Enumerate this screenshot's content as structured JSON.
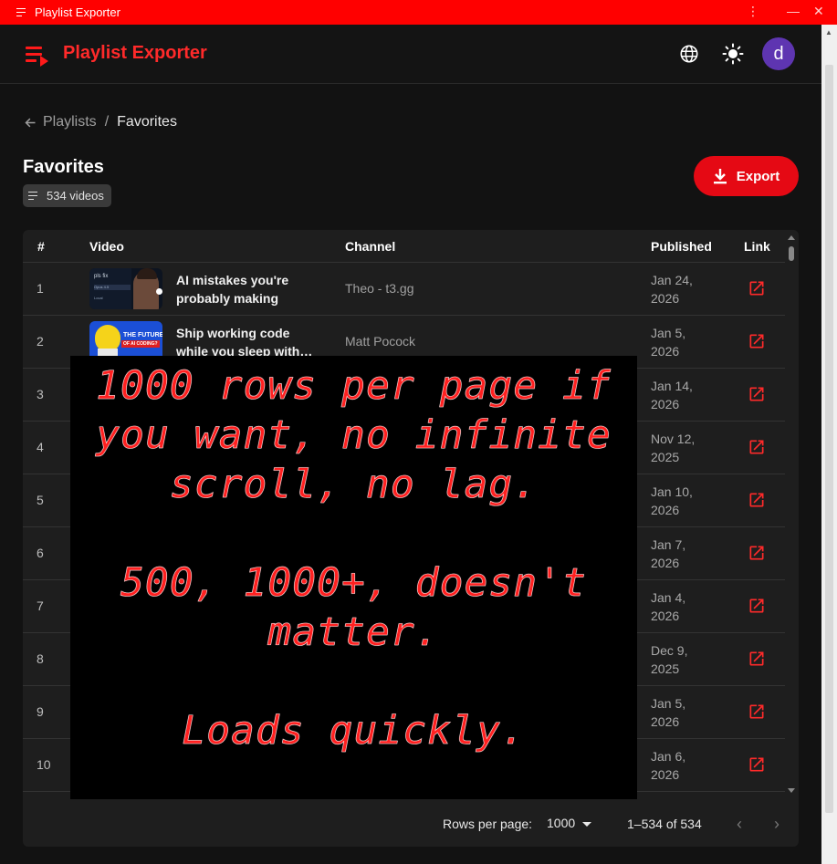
{
  "window": {
    "title": "Playlist Exporter",
    "controls": [
      "⋮",
      "—",
      "✕"
    ]
  },
  "appbar": {
    "title": "Playlist Exporter",
    "avatar_letter": "d",
    "icons": [
      "globe-icon",
      "sun-icon"
    ]
  },
  "breadcrumb": {
    "back_label": "Playlists",
    "separator": "/",
    "current": "Favorites"
  },
  "page": {
    "title": "Favorites",
    "video_count": "534 videos"
  },
  "export_button": {
    "label": "Export"
  },
  "table": {
    "columns": [
      "#",
      "Video",
      "Channel",
      "Published",
      "Link"
    ],
    "rows": [
      {
        "num": "1",
        "title_line1": "AI mistakes you're",
        "title_line2": "probably making",
        "channel": "Theo - t3.gg",
        "pub_line1": "Jan 24,",
        "pub_line2": "2026"
      },
      {
        "num": "2",
        "title_line1": "Ship working code",
        "title_line2": "while you sleep with…",
        "channel": "Matt Pocock",
        "pub_line1": "Jan 5,",
        "pub_line2": "2026"
      },
      {
        "num": "3",
        "title_line1": "",
        "title_line2": "",
        "channel": "",
        "pub_line1": "Jan 14,",
        "pub_line2": "2026"
      },
      {
        "num": "4",
        "title_line1": "",
        "title_line2": "",
        "channel": "",
        "pub_line1": "Nov 12,",
        "pub_line2": "2025"
      },
      {
        "num": "5",
        "title_line1": "",
        "title_line2": "",
        "channel": "",
        "pub_line1": "Jan 10,",
        "pub_line2": "2026"
      },
      {
        "num": "6",
        "title_line1": "",
        "title_line2": "",
        "channel": "",
        "pub_line1": "Jan 7,",
        "pub_line2": "2026"
      },
      {
        "num": "7",
        "title_line1": "",
        "title_line2": "",
        "channel": "",
        "pub_line1": "Jan 4,",
        "pub_line2": "2026"
      },
      {
        "num": "8",
        "title_line1": "",
        "title_line2": "",
        "channel": "",
        "pub_line1": "Dec 9,",
        "pub_line2": "2025"
      },
      {
        "num": "9",
        "title_line1": "",
        "title_line2": "",
        "channel": "",
        "pub_line1": "Jan 5,",
        "pub_line2": "2026"
      },
      {
        "num": "10",
        "title_line1": "",
        "title_line2": "",
        "channel": "",
        "pub_line1": "Jan 6,",
        "pub_line2": "2026"
      }
    ]
  },
  "thumb1": {
    "line1": "pls fix",
    "line2": "Opus 4.5",
    "line3": "Local"
  },
  "thumb2": {
    "line1": "THE FUTURE",
    "line2": "OF AI CODING?"
  },
  "pagination": {
    "rows_per_page_label": "Rows per page:",
    "rows_per_page_value": "1000",
    "range": "1–534 of 534",
    "prev": "‹",
    "next": "›"
  },
  "overlay": {
    "lines": [
      "1000 rows per page if",
      "you want, no infinite",
      "scroll, no lag.",
      "500, 1000+, doesn't",
      "matter.",
      "Loads quickly."
    ]
  },
  "colors": {
    "accent": "#e50914",
    "title_red": "#ff2a2a",
    "titlebar": "#ff0000",
    "avatar": "#5e35b1",
    "background": "#121212",
    "card": "#1e1e1e"
  }
}
